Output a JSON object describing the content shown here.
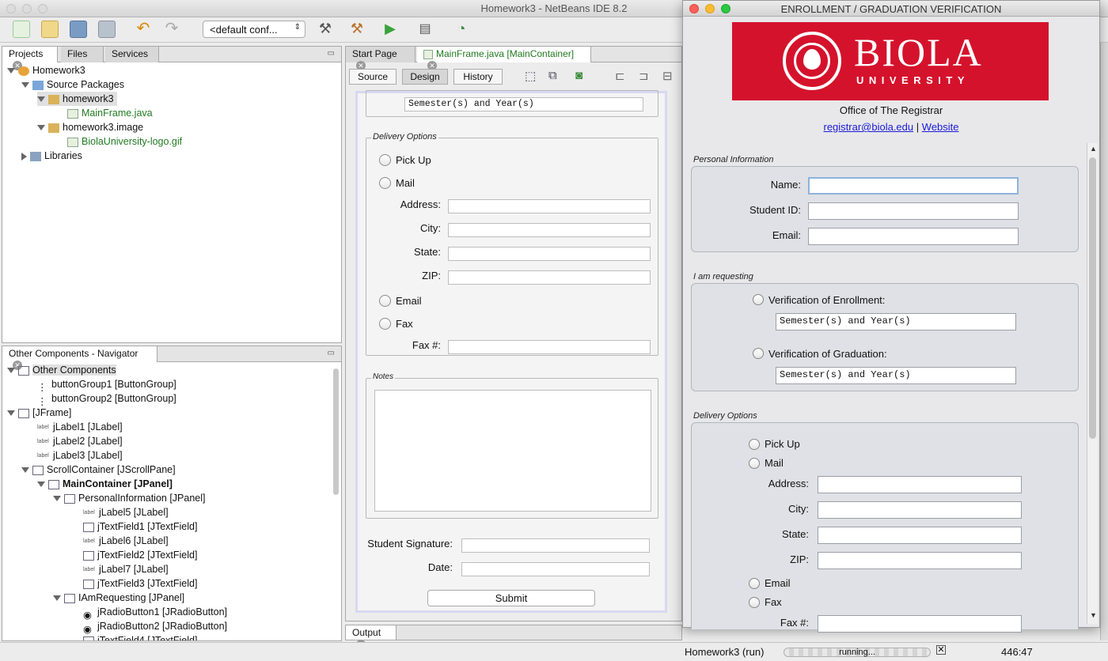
{
  "ide": {
    "title": "Homework3 - NetBeans IDE 8.2",
    "config": "<default conf...",
    "colors": {
      "accent": "#217a21"
    }
  },
  "left": {
    "tabs": [
      "Projects",
      "Files",
      "Services"
    ],
    "tree": [
      {
        "label": "Homework3"
      },
      {
        "label": "Source Packages"
      },
      {
        "label": "homework3"
      },
      {
        "label": "MainFrame.java"
      },
      {
        "label": "homework3.image"
      },
      {
        "label": "BiolaUniversity-logo.gif"
      },
      {
        "label": "Libraries"
      }
    ]
  },
  "navigator": {
    "title": "Other Components - Navigator",
    "items": [
      "Other Components",
      "buttonGroup1 [ButtonGroup]",
      "buttonGroup2 [ButtonGroup]",
      "[JFrame]",
      "jLabel1 [JLabel]",
      "jLabel2 [JLabel]",
      "jLabel3 [JLabel]",
      "ScrollContainer [JScrollPane]",
      "MainContainer [JPanel]",
      "PersonalInformation [JPanel]",
      "jLabel5 [JLabel]",
      "jTextField1 [JTextField]",
      "jLabel6 [JLabel]",
      "jTextField2 [JTextField]",
      "jLabel7 [JLabel]",
      "jTextField3 [JTextField]",
      "IAmRequesting [JPanel]",
      "jRadioButton1 [JRadioButton]",
      "jRadioButton2 [JRadioButton]",
      "jTextField4 [JTextField]"
    ]
  },
  "editor": {
    "tabs": [
      "Start Page",
      "MainFrame.java [MainContainer]"
    ],
    "views": [
      "Source",
      "Design",
      "History"
    ],
    "semester": "Semester(s) and Year(s)",
    "delivery": "Delivery Options",
    "pickup": "Pick Up",
    "mail": "Mail",
    "address": "Address:",
    "city": "City:",
    "state": "State:",
    "zip": "ZIP:",
    "email": "Email",
    "fax": "Fax",
    "faxnum": "Fax #:",
    "notes": "Notes",
    "signature": "Student Signature:",
    "date": "Date:",
    "submit": "Submit"
  },
  "output": {
    "label": "Output"
  },
  "status": {
    "task": "Homework3 (run)",
    "progress": "running...",
    "pos": "446:47"
  },
  "window": {
    "title": "ENROLLMENT / GRADUATION VERIFICATION",
    "logo_big": "BIOLA",
    "logo_small": "UNIVERSITY",
    "office": "Office of The Registrar",
    "email": "registrar@biola.edu",
    "sep": "|",
    "website": "Website",
    "personal": "Personal Information",
    "name": "Name:",
    "sid": "Student ID:",
    "wemail": "Email:",
    "requesting": "I am requesting",
    "enroll": "Verification of Enrollment:",
    "grad": "Verification of Graduation:",
    "semester": "Semester(s) and Year(s)",
    "delivery": "Delivery Options",
    "pickup": "Pick Up",
    "mail": "Mail",
    "address": "Address:",
    "city": "City:",
    "state": "State:",
    "zip": "ZIP:",
    "email_opt": "Email",
    "fax": "Fax",
    "faxnum": "Fax #:"
  }
}
